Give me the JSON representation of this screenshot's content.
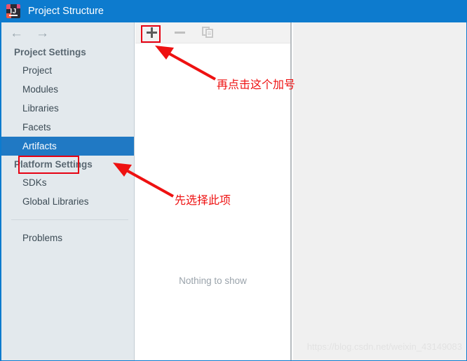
{
  "window": {
    "title": "Project Structure",
    "icon": "intellij-idea-icon",
    "title_bar_color": "#0d7bce"
  },
  "nav": {
    "back_icon": "arrow-left-icon",
    "forward_icon": "arrow-right-icon"
  },
  "sidebar": {
    "background_color": "#e3e9ed",
    "selection_color": "#2079c4",
    "groups": [
      {
        "title": "Project Settings",
        "items": [
          {
            "label": "Project",
            "selected": false
          },
          {
            "label": "Modules",
            "selected": false
          },
          {
            "label": "Libraries",
            "selected": false
          },
          {
            "label": "Facets",
            "selected": false
          },
          {
            "label": "Artifacts",
            "selected": true
          }
        ]
      },
      {
        "title": "Platform Settings",
        "items": [
          {
            "label": "SDKs",
            "selected": false
          },
          {
            "label": "Global Libraries",
            "selected": false
          }
        ]
      }
    ],
    "footer_items": [
      {
        "label": "Problems",
        "selected": false
      }
    ]
  },
  "toolbar": {
    "buttons": [
      {
        "name": "add-button",
        "icon": "plus-icon",
        "enabled": true
      },
      {
        "name": "remove-button",
        "icon": "minus-icon",
        "enabled": false
      },
      {
        "name": "copy-button",
        "icon": "copy-icon",
        "enabled": false
      }
    ]
  },
  "main": {
    "empty_message": "Nothing to show"
  },
  "annotations": {
    "color": "#ee1111",
    "callouts": [
      {
        "text": "再点击这个加号",
        "target": "add-button"
      },
      {
        "text": "先选择此项",
        "target": "sidebar-item-artifacts"
      }
    ],
    "highlight_boxes": [
      {
        "target": "add-button"
      },
      {
        "target": "sidebar-item-artifacts"
      }
    ]
  },
  "watermark": {
    "text": "https://blog.csdn.net/weixin_43149083"
  }
}
